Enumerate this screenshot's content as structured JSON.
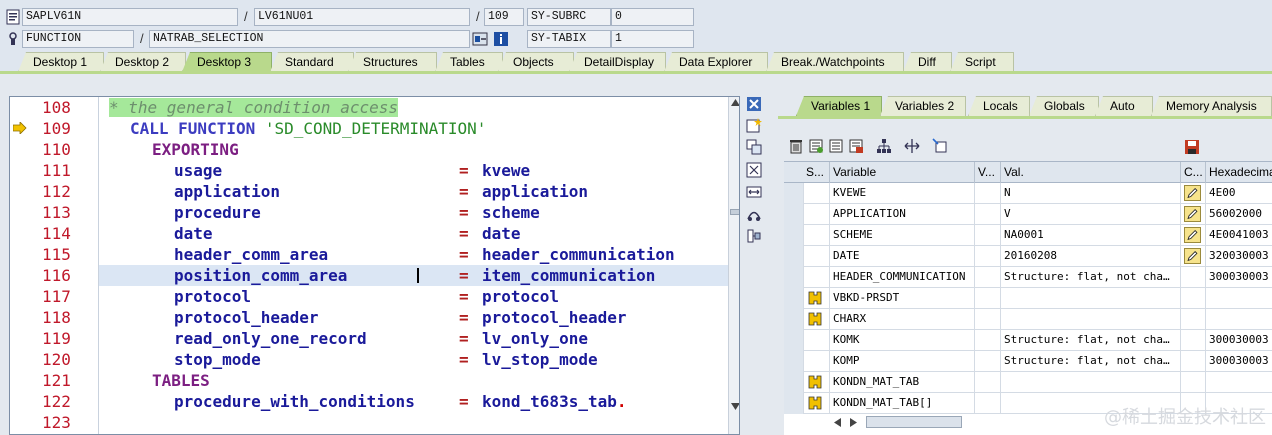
{
  "info": {
    "program": "SAPLV61N",
    "include": "LV61NU01",
    "line": "109",
    "var1_name": "SY-SUBRC",
    "var1_value": "0",
    "event_type": "FUNCTION",
    "event_name": "NATRAB_SELECTION",
    "var2_name": "SY-TABIX",
    "var2_value": "1",
    "separator": "/"
  },
  "tabs": [
    {
      "label": "Desktop 1",
      "active": false
    },
    {
      "label": "Desktop 2",
      "active": false
    },
    {
      "label": "Desktop 3",
      "active": true
    },
    {
      "label": "Standard",
      "active": false
    },
    {
      "label": "Structures",
      "active": false
    },
    {
      "label": "Tables",
      "active": false
    },
    {
      "label": "Objects",
      "active": false
    },
    {
      "label": "DetailDisplay",
      "active": false
    },
    {
      "label": "Data Explorer",
      "active": false
    },
    {
      "label": "Break./Watchpoints",
      "active": false
    },
    {
      "label": "Diff",
      "active": false
    },
    {
      "label": "Script",
      "active": false
    }
  ],
  "code": {
    "current_line": "109",
    "lines": [
      {
        "no": "108",
        "comment": "* the general condition access"
      },
      {
        "no": "109",
        "kw": "CALL FUNCTION",
        "str": "'SD_COND_DETERMINATION'"
      },
      {
        "no": "110",
        "kw2": "EXPORTING"
      },
      {
        "no": "111",
        "param": "usage",
        "eq": "=",
        "val": "kvewe"
      },
      {
        "no": "112",
        "param": "application",
        "eq": "=",
        "val": "application"
      },
      {
        "no": "113",
        "param": "procedure",
        "eq": "=",
        "val": "scheme"
      },
      {
        "no": "114",
        "param": "date",
        "eq": "=",
        "val": "date"
      },
      {
        "no": "115",
        "param": "header_comm_area",
        "eq": "=",
        "val": "header_communication"
      },
      {
        "no": "116",
        "param": "position_comm_area",
        "eq": "=",
        "val": "item_communication"
      },
      {
        "no": "117",
        "param": "protocol",
        "eq": "=",
        "val": "protocol"
      },
      {
        "no": "118",
        "param": "protocol_header",
        "eq": "=",
        "val": "protocol_header"
      },
      {
        "no": "119",
        "param": "read_only_one_record",
        "eq": "=",
        "val": "lv_only_one"
      },
      {
        "no": "120",
        "param": "stop_mode",
        "eq": "=",
        "val": "lv_stop_mode"
      },
      {
        "no": "121",
        "kw2": "TABLES"
      },
      {
        "no": "122",
        "param": "procedure_with_conditions",
        "eq": "=",
        "val": "kond_t683s_tab",
        "dot": "."
      },
      {
        "no": "123"
      }
    ]
  },
  "right_tabs": [
    {
      "label": "Variables 1",
      "active": true
    },
    {
      "label": "Variables 2",
      "active": false
    },
    {
      "label": "Locals",
      "active": false
    },
    {
      "label": "Globals",
      "active": false
    },
    {
      "label": "Auto",
      "active": false
    },
    {
      "label": "Memory Analysis",
      "active": false
    }
  ],
  "var_table": {
    "headers": {
      "s": "S...",
      "variable": "Variable",
      "v": "V...",
      "val": "Val.",
      "c": "C...",
      "hex": "Hexadecima"
    },
    "rows": [
      {
        "icon": "",
        "variable": "KVEWE",
        "val": "N",
        "edit": true,
        "hex": "4E00"
      },
      {
        "icon": "",
        "variable": "APPLICATION",
        "val": "V",
        "edit": true,
        "hex": "56002000"
      },
      {
        "icon": "",
        "variable": "SCHEME",
        "val": "NA0001",
        "edit": true,
        "hex": "4E0041003"
      },
      {
        "icon": "",
        "variable": "DATE",
        "val": "20160208",
        "edit": true,
        "hex": "320030003"
      },
      {
        "icon": "",
        "variable": "HEADER_COMMUNICATION",
        "val": "Structure: flat, not cha…",
        "edit": false,
        "hex": "300030003"
      },
      {
        "icon": "table",
        "variable": "VBKD-PRSDT",
        "val": "",
        "edit": false,
        "hex": ""
      },
      {
        "icon": "table",
        "variable": "CHARX",
        "val": "",
        "edit": false,
        "hex": ""
      },
      {
        "icon": "",
        "variable": "KOMK",
        "val": "Structure: flat, not cha…",
        "edit": false,
        "hex": "300030003"
      },
      {
        "icon": "",
        "variable": "KOMP",
        "val": "Structure: flat, not cha…",
        "edit": false,
        "hex": "300030003"
      },
      {
        "icon": "table",
        "variable": "KONDN_MAT_TAB",
        "val": "",
        "edit": false,
        "hex": ""
      },
      {
        "icon": "table",
        "variable": "KONDN_MAT_TAB[]",
        "val": "",
        "edit": false,
        "hex": ""
      }
    ]
  },
  "watermark": "@稀土掘金技术社区"
}
